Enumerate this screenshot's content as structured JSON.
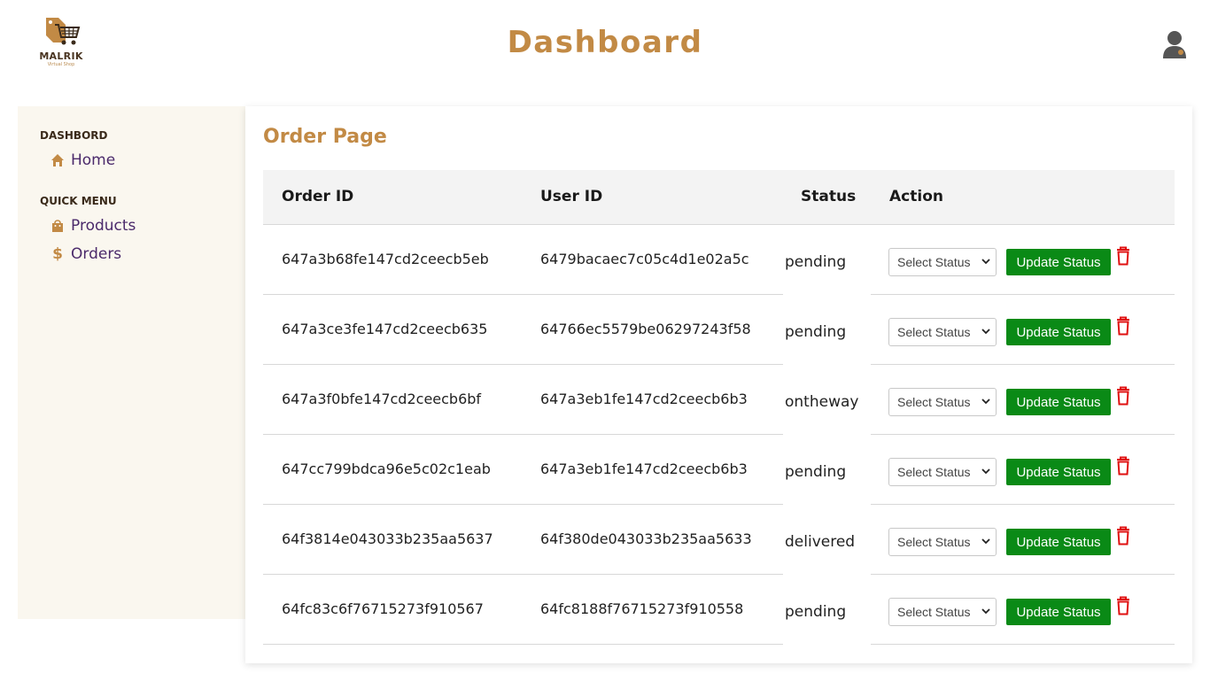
{
  "header": {
    "logo_name": "MALRIK",
    "logo_sub": "Virtual Shop",
    "title": "Dashboard"
  },
  "sidebar": {
    "sections": [
      {
        "label": "DASHBORD",
        "items": [
          {
            "label": "Home",
            "icon": "home-icon"
          }
        ]
      },
      {
        "label": "QUICK MENU",
        "items": [
          {
            "label": "Products",
            "icon": "shopping-bag-icon"
          },
          {
            "label": "Orders",
            "icon": "dollar-icon"
          }
        ]
      }
    ]
  },
  "main": {
    "title": "Order Page",
    "columns": [
      "Order ID",
      "User ID",
      "Status",
      "Action"
    ],
    "select_placeholder": "Select Status",
    "update_label": "Update Status",
    "orders": [
      {
        "order_id": "647a3b68fe147cd2ceecb5eb",
        "user_id": "6479bacaec7c05c4d1e02a5c",
        "status": "pending"
      },
      {
        "order_id": "647a3ce3fe147cd2ceecb635",
        "user_id": "64766ec5579be06297243f58",
        "status": "pending"
      },
      {
        "order_id": "647a3f0bfe147cd2ceecb6bf",
        "user_id": "647a3eb1fe147cd2ceecb6b3",
        "status": "ontheway"
      },
      {
        "order_id": "647cc799bdca96e5c02c1eab",
        "user_id": "647a3eb1fe147cd2ceecb6b3",
        "status": "pending"
      },
      {
        "order_id": "64f3814e043033b235aa5637",
        "user_id": "64f380de043033b235aa5633",
        "status": "delivered"
      },
      {
        "order_id": "64fc83c6f76715273f910567",
        "user_id": "64fc8188f76715273f910558",
        "status": "pending"
      }
    ]
  },
  "colors": {
    "accent": "#c28a45",
    "sidebar_bg": "#faf7ef",
    "nav_text": "#4b2a6b",
    "update_button": "#0a8a16",
    "delete_icon": "#e01010"
  }
}
